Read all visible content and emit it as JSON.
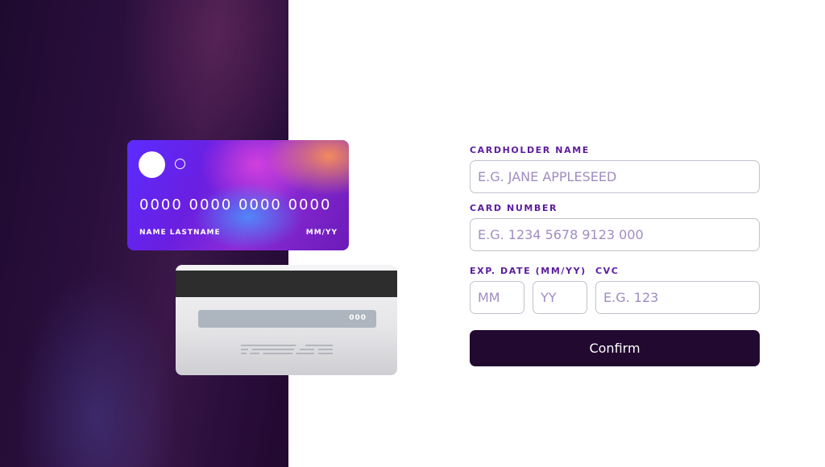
{
  "card_front": {
    "number": "0000 0000 0000 0000",
    "name": "NAME LASTNAME",
    "expiry": "MM/YY"
  },
  "card_back": {
    "cvc": "000"
  },
  "form": {
    "cardholder_label": "CARDHOLDER NAME",
    "cardholder_placeholder": "E.G. JANE APPLESEED",
    "number_label": "CARD NUMBER",
    "number_placeholder": "E.G. 1234 5678 9123 000",
    "expiry_label": "EXP. DATE (MM/YY)",
    "month_placeholder": "MM",
    "year_placeholder": "YY",
    "cvc_label": "CVC",
    "cvc_placeholder": "E.G. 123",
    "confirm_label": "Confirm"
  },
  "colors": {
    "panel_dark": "#21092f",
    "label_purple": "#5c1c9e",
    "placeholder": "#a08cc2",
    "input_border": "#c5c0ce"
  }
}
